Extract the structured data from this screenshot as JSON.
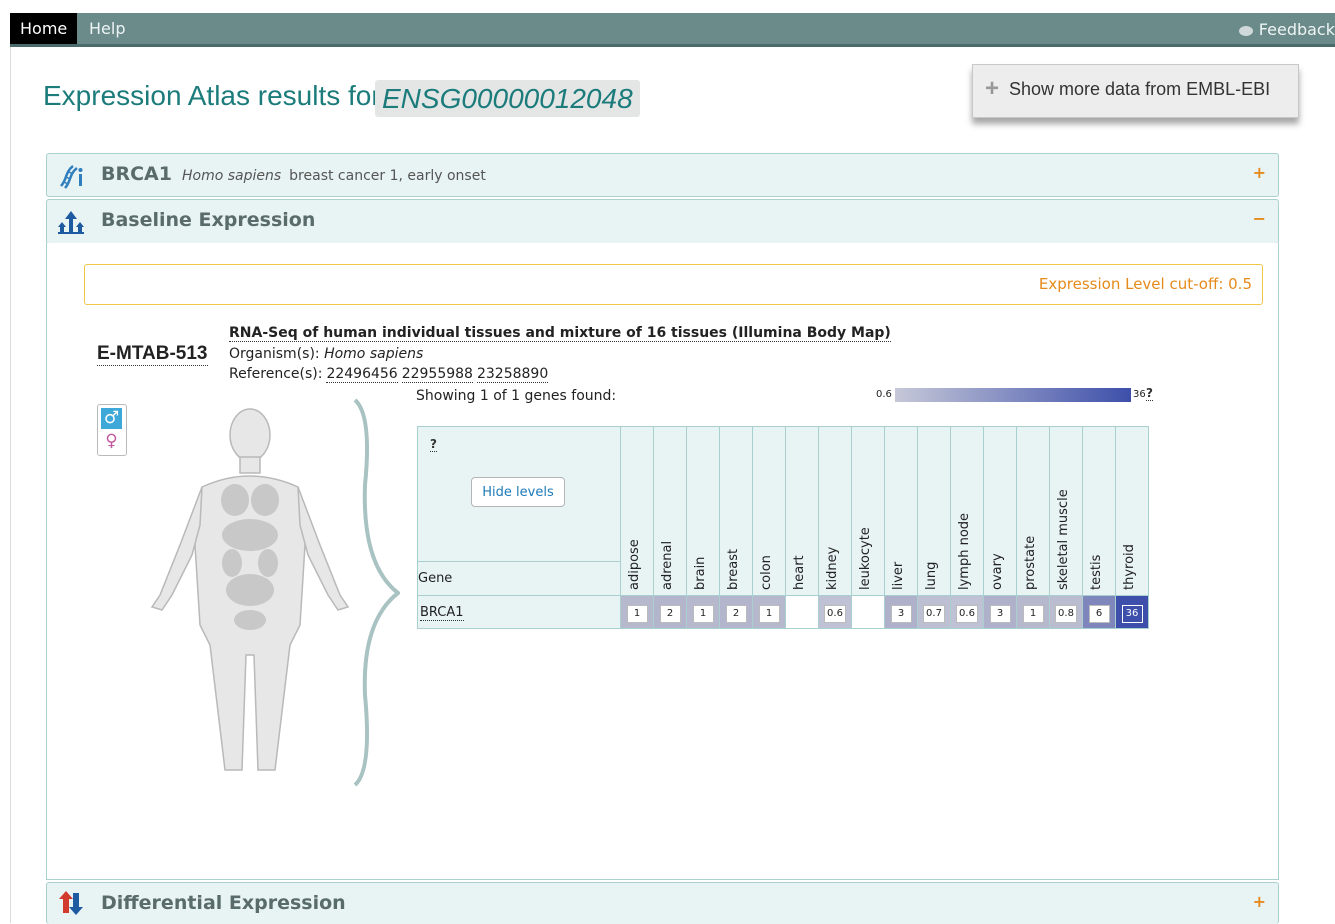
{
  "nav": {
    "home_label": "Home",
    "help_label": "Help",
    "feedback_label": "Feedback"
  },
  "header": {
    "title_prefix": "Expression Atlas results for",
    "gene_id": "ENSG00000012048",
    "more_data_label": "Show more data from EMBL-EBI"
  },
  "gene_panel": {
    "symbol": "BRCA1",
    "species": "Homo sapiens",
    "description": "breast cancer 1, early onset",
    "toggle": "+",
    "icon": "gene-info-icon"
  },
  "baseline_panel": {
    "title": "Baseline Expression",
    "toggle": "−",
    "icon": "baseline-expression-icon"
  },
  "cutoff": {
    "label": "Expression Level cut-off: 0.5"
  },
  "experiment": {
    "accession": "E-MTAB-513",
    "title": "RNA-Seq of human individual tissues and mixture of 16 tissues (Illumina Body Map)",
    "organism_label": "Organism(s):",
    "organism": "Homo sapiens",
    "references_label": "Reference(s):",
    "references": [
      "22496456",
      "22955988",
      "23258890"
    ]
  },
  "gender_toggle": {
    "male_symbol": "♂",
    "female_symbol": "♀"
  },
  "results": {
    "showing": "Showing 1 of 1 genes found:",
    "scale_min": "0.6",
    "scale_max": "36",
    "scale_help": "?",
    "scale_colors": [
      "#c6c8d8",
      "#3d4faa"
    ]
  },
  "heatmap": {
    "help": "?",
    "hide_levels_label": "Hide levels",
    "gene_column_label": "Gene",
    "tissues": [
      "adipose",
      "adrenal",
      "brain",
      "breast",
      "colon",
      "heart",
      "kidney",
      "leukocyte",
      "liver",
      "lung",
      "lymph node",
      "ovary",
      "prostate",
      "skeletal muscle",
      "testis",
      "thyroid"
    ],
    "rows": [
      {
        "gene": "BRCA1",
        "values": [
          "1",
          "2",
          "1",
          "2",
          "1",
          "",
          "0.6",
          "",
          "3",
          "0.7",
          "0.6",
          "3",
          "1",
          "0.8",
          "6",
          "36"
        ],
        "colors": [
          "#b6b8cd",
          "#b2b5cb",
          "#b6b8cd",
          "#b2b5cb",
          "#b6b8cd",
          "#ffffff",
          "#bfc1d4",
          "#ffffff",
          "#aeb1c9",
          "#bdbfd2",
          "#bfc1d4",
          "#aeb1c9",
          "#b6b8cd",
          "#babcd0",
          "#7f86bb",
          "#3d4faa"
        ]
      }
    ]
  },
  "diff_panel": {
    "title": "Differential Expression",
    "toggle": "+",
    "icon": "differential-expression-icon"
  }
}
